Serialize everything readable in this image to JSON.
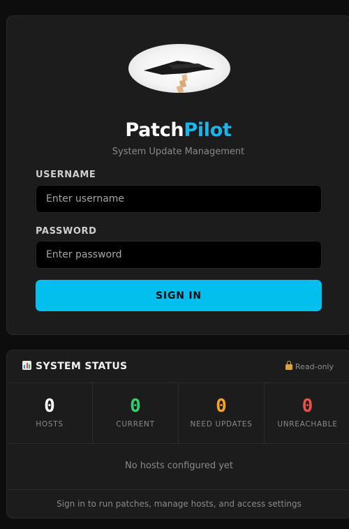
{
  "login": {
    "brand_part1": "Patch",
    "brand_part2": "Pilot",
    "tagline": "System Update Management",
    "username_label": "USERNAME",
    "username_placeholder": "Enter username",
    "password_label": "PASSWORD",
    "password_placeholder": "Enter password",
    "signin_label": "SIGN IN"
  },
  "status": {
    "icon": "bar-chart-icon",
    "title": "SYSTEM STATUS",
    "readonly_icon": "lock-icon",
    "readonly_label": "Read-only",
    "stats": [
      {
        "value": "0",
        "label": "HOSTS",
        "color": "#ffffff"
      },
      {
        "value": "0",
        "label": "CURRENT",
        "color": "#2fd26a"
      },
      {
        "value": "0",
        "label": "NEED UPDATES",
        "color": "#f5a524"
      },
      {
        "value": "0",
        "label": "UNREACHABLE",
        "color": "#ea5147"
      }
    ],
    "empty_message": "No hosts configured yet",
    "footer_hint": "Sign in to run patches, manage hosts, and access settings"
  },
  "colors": {
    "accent": "#03bfee",
    "background": "#0d0d0d",
    "card": "#1c1c1c"
  }
}
